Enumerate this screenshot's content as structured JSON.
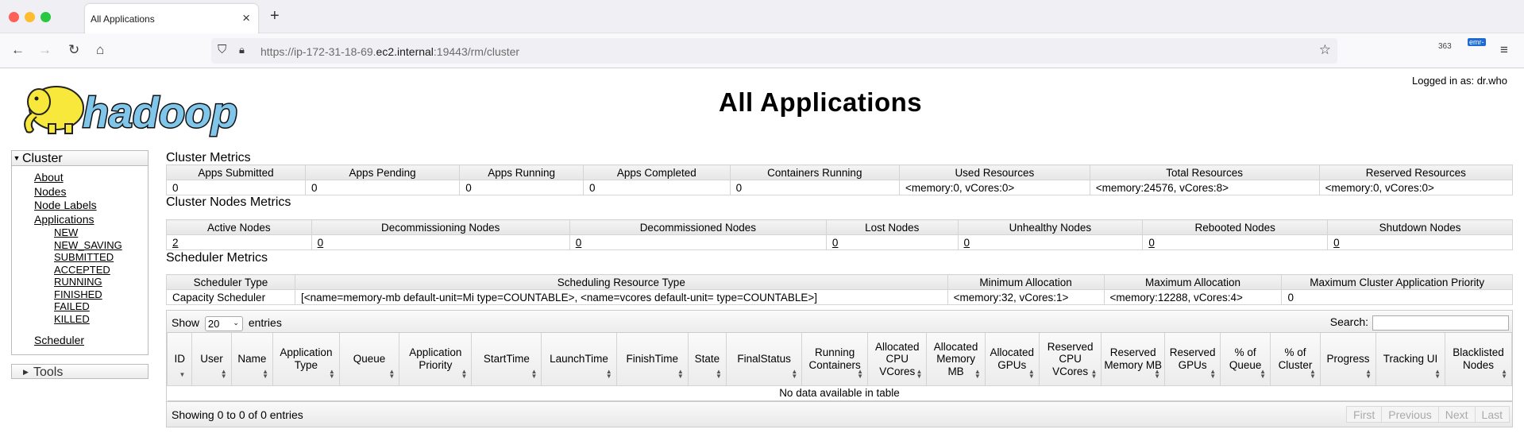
{
  "browser": {
    "tab_title": "All Applications",
    "url_host_prefix": "https://ip-172-31-18-69.",
    "url_host_main": "ec2.internal",
    "url_rest": ":19443/rm/cluster",
    "ext1_label": "363",
    "ext2_label": "emr-"
  },
  "header": {
    "logged_in": "Logged in as: dr.who",
    "title": "All Applications",
    "logo_text": "hadoop"
  },
  "sidebar": {
    "cluster_label": "Cluster",
    "items": [
      "About",
      "Nodes",
      "Node Labels",
      "Applications"
    ],
    "app_states": [
      "NEW",
      "NEW_SAVING",
      "SUBMITTED",
      "ACCEPTED",
      "RUNNING",
      "FINISHED",
      "FAILED",
      "KILLED"
    ],
    "scheduler": "Scheduler",
    "tools_label": "Tools"
  },
  "cluster_metrics": {
    "title": "Cluster Metrics",
    "headers": [
      "Apps Submitted",
      "Apps Pending",
      "Apps Running",
      "Apps Completed",
      "Containers Running",
      "Used Resources",
      "Total Resources",
      "Reserved Resources"
    ],
    "values": [
      "0",
      "0",
      "0",
      "0",
      "0",
      "<memory:0, vCores:0>",
      "<memory:24576, vCores:8>",
      "<memory:0, vCores:0>"
    ]
  },
  "nodes_metrics": {
    "title": "Cluster Nodes Metrics",
    "headers": [
      "Active Nodes",
      "Decommissioning Nodes",
      "Decommissioned Nodes",
      "Lost Nodes",
      "Unhealthy Nodes",
      "Rebooted Nodes",
      "Shutdown Nodes"
    ],
    "values": [
      "2",
      "0",
      "0",
      "0",
      "0",
      "0",
      "0"
    ]
  },
  "scheduler_metrics": {
    "title": "Scheduler Metrics",
    "headers": [
      "Scheduler Type",
      "Scheduling Resource Type",
      "Minimum Allocation",
      "Maximum Allocation",
      "Maximum Cluster Application Priority"
    ],
    "values": [
      "Capacity Scheduler",
      "[<name=memory-mb default-unit=Mi type=COUNTABLE>, <name=vcores default-unit= type=COUNTABLE>]",
      "<memory:32, vCores:1>",
      "<memory:12288, vCores:4>",
      "0"
    ]
  },
  "apps_table": {
    "show_label": "Show",
    "entries_label": "entries",
    "page_length": "20",
    "search_label": "Search:",
    "columns": [
      "ID",
      "User",
      "Name",
      "Application Type",
      "Queue",
      "Application Priority",
      "StartTime",
      "LaunchTime",
      "FinishTime",
      "State",
      "FinalStatus",
      "Running Containers",
      "Allocated CPU VCores",
      "Allocated Memory MB",
      "Allocated GPUs",
      "Reserved CPU VCores",
      "Reserved Memory MB",
      "Reserved GPUs",
      "% of Queue",
      "% of Cluster",
      "Progress",
      "Tracking UI",
      "Blacklisted Nodes"
    ],
    "empty_message": "No data available in table",
    "info": "Showing 0 to 0 of 0 entries",
    "pager": [
      "First",
      "Previous",
      "Next",
      "Last"
    ]
  }
}
